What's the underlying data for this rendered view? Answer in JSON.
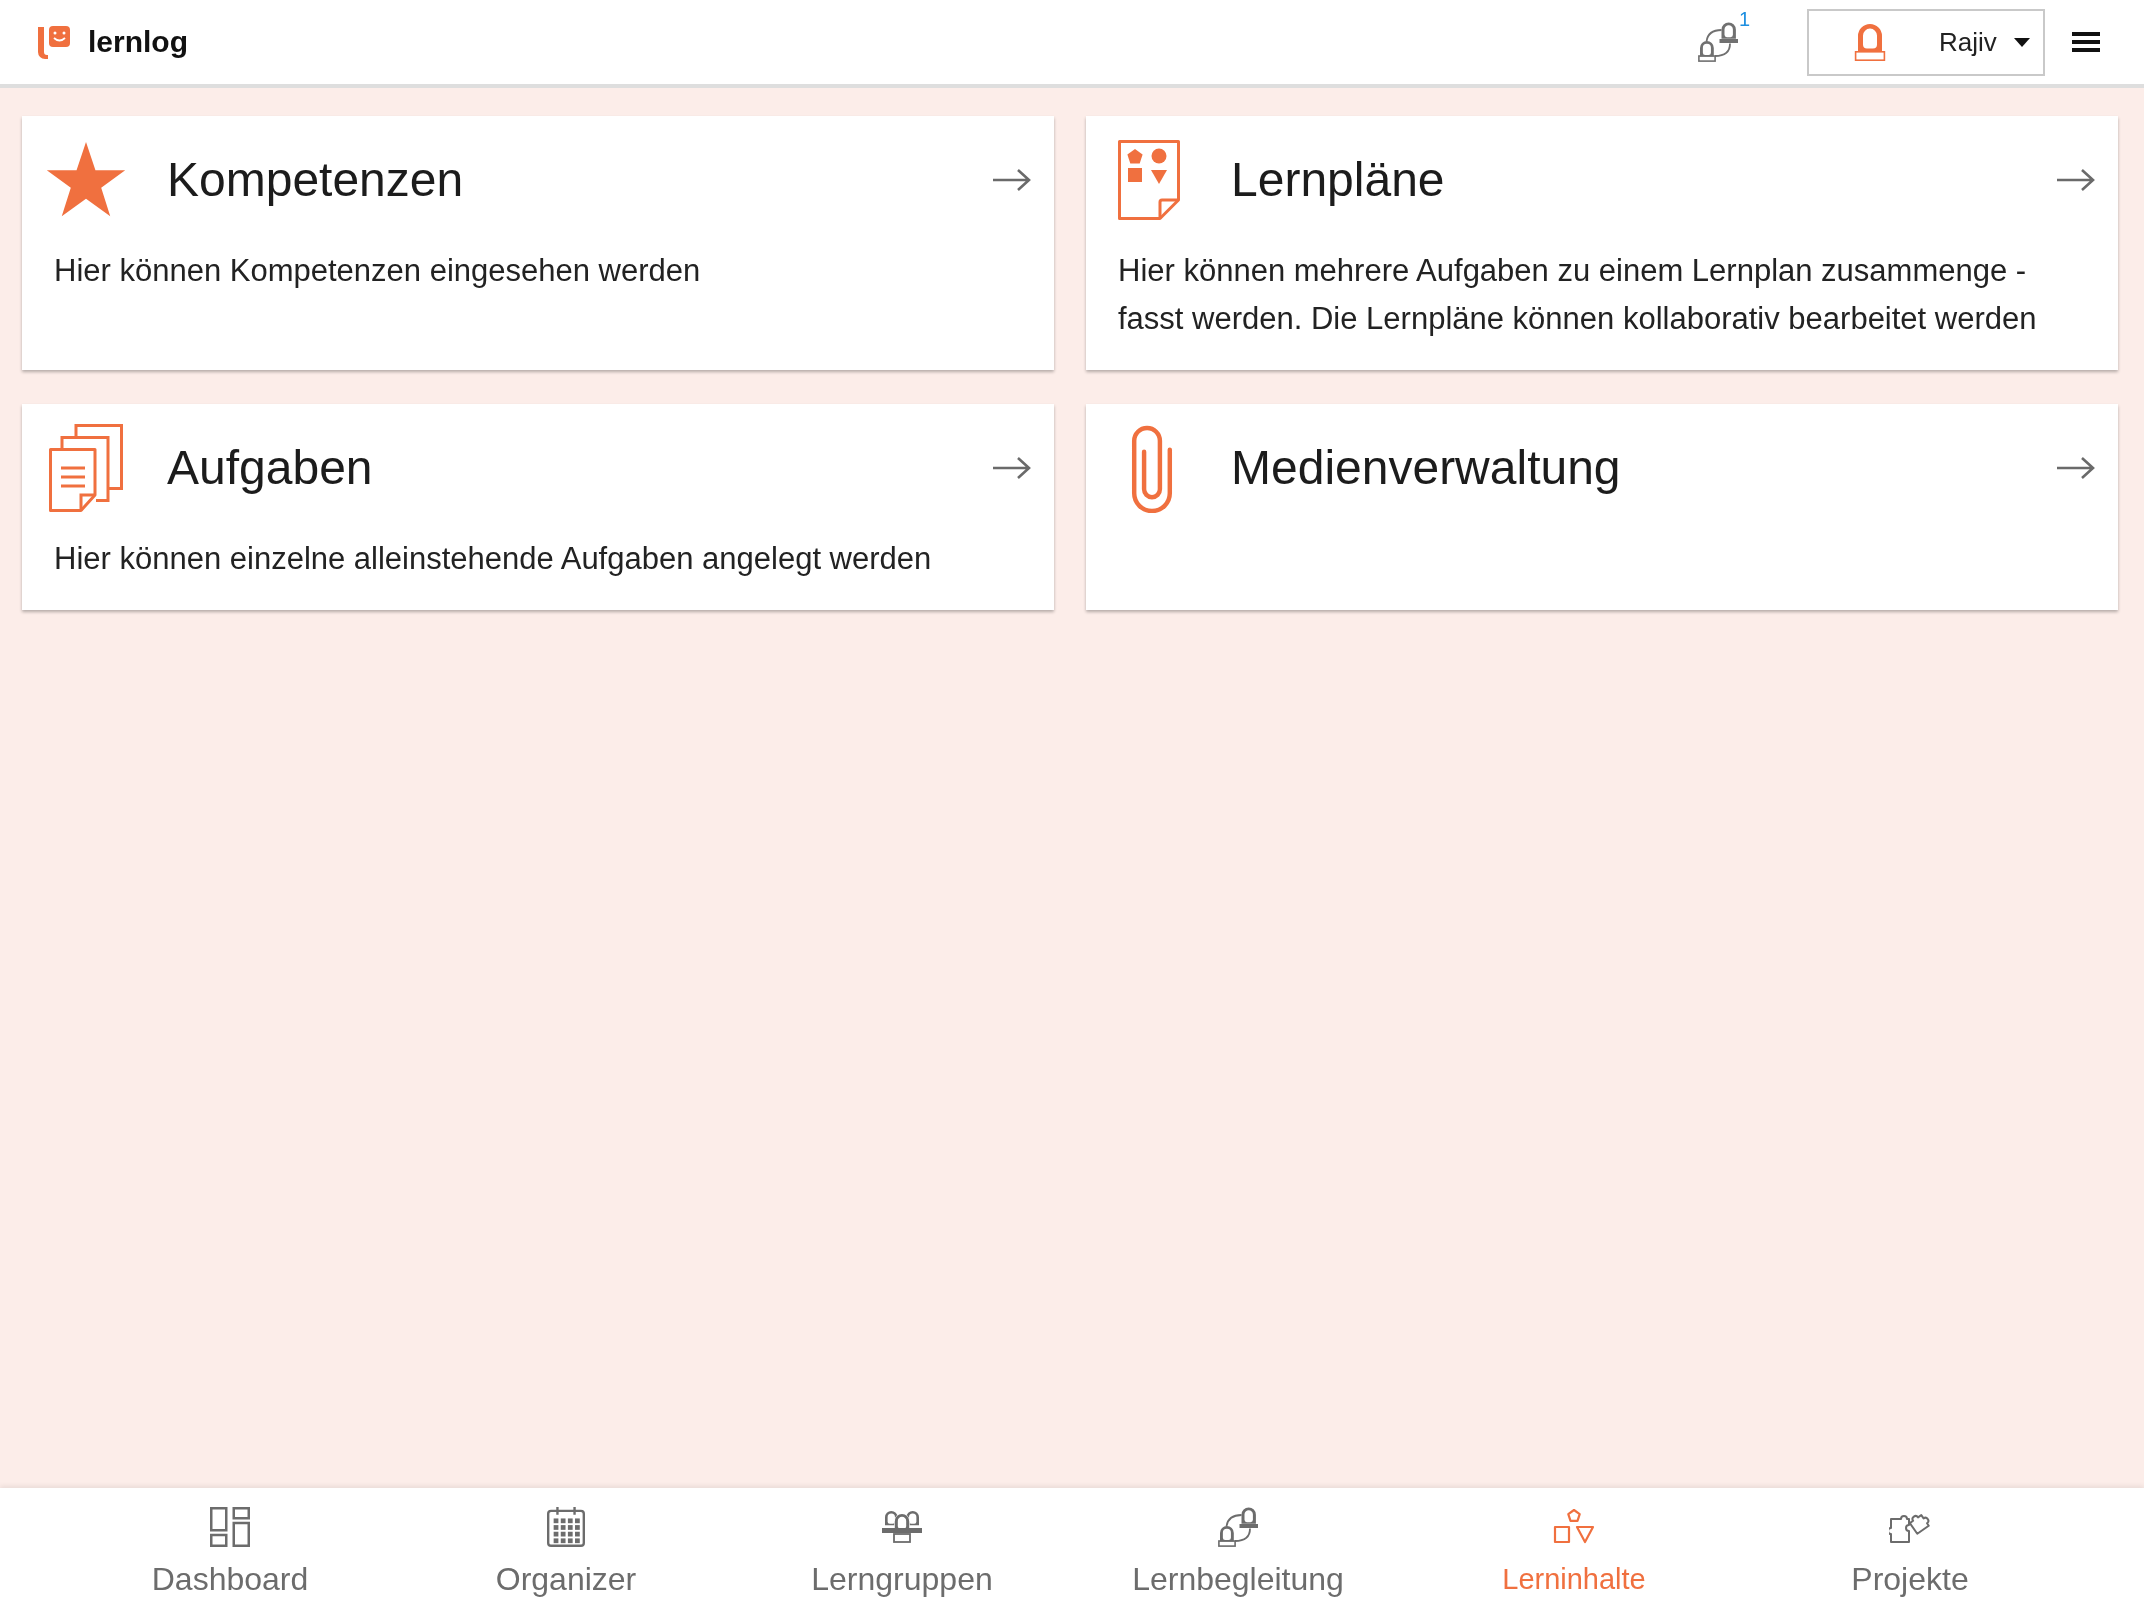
{
  "header": {
    "logo_text": "lernlog",
    "notifications": {
      "count": "1"
    },
    "user_menu": {
      "name": "Rajiv"
    }
  },
  "cards": [
    {
      "title": "Kompetenzen",
      "description": "Hier können Kompetenzen eingesehen werden"
    },
    {
      "title": "Lernpläne",
      "description": "Hier können mehrere Aufgaben zu einem Lernplan zusammenge - fasst werden. Die Lernpläne können kollaborativ bearbeitet werden"
    },
    {
      "title": "Aufgaben",
      "description": "Hier können einzelne alleinstehende Aufgaben angelegt werden"
    },
    {
      "title": "Medienverwaltung"
    }
  ],
  "bottom_nav": [
    {
      "label": "Dashboard",
      "selected": false
    },
    {
      "label": "Organizer",
      "selected": false
    },
    {
      "label": "Lerngruppen",
      "selected": false
    },
    {
      "label": "Lernbegleitung",
      "selected": false
    },
    {
      "label": "Lerninhalte",
      "selected": true
    },
    {
      "label": "Projekte",
      "selected": false
    }
  ]
}
